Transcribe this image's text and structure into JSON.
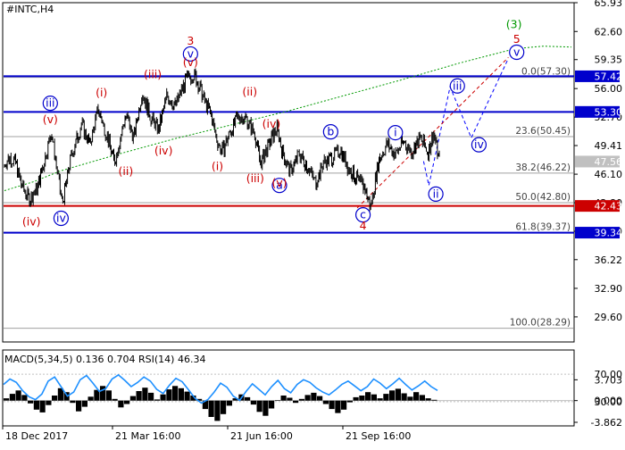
{
  "chart_data": {
    "type": "line",
    "symbol": "#INTC,H4",
    "price_panel": {
      "ylim": [
        26.7,
        65.93
      ],
      "y_ticks": [
        65.93,
        62.6,
        59.35,
        56.0,
        52.7,
        49.41,
        46.1,
        42.8,
        39.5,
        36.22,
        32.9,
        29.6
      ],
      "y_tick_labels": [
        "65.93",
        "62.60",
        "59.35",
        "56.00",
        "52.70",
        "49.41",
        "46.10",
        "42.80",
        "39.50",
        "36.22",
        "32.90",
        "29.60"
      ],
      "x_labels": [
        "18 Dec 2017",
        "21 Mar 16:00",
        "21 Jun 16:00",
        "21 Sep 16:00"
      ],
      "last_price": {
        "value": 47.56,
        "label": "47.56"
      },
      "levels": [
        {
          "value": 57.42,
          "label": "57.42",
          "color": "#0000cc"
        },
        {
          "value": 53.3,
          "label": "53.30",
          "color": "#0000cc"
        },
        {
          "value": 42.43,
          "label": "42.43",
          "color": "#cc0000"
        },
        {
          "value": 39.34,
          "label": "39.34",
          "color": "#0000cc"
        }
      ],
      "fibonacci": [
        {
          "value": 57.3,
          "label": "0.0(57.30)"
        },
        {
          "value": 50.45,
          "label": "23.6(50.45)"
        },
        {
          "value": 46.22,
          "label": "38.2(46.22)"
        },
        {
          "value": 42.8,
          "label": "50.0(42.80)"
        },
        {
          "value": 39.37,
          "label": "61.8(39.37)"
        },
        {
          "value": 28.29,
          "label": "100.0(28.29)"
        }
      ],
      "moving_average": {
        "color": "#009900",
        "points": [
          [
            0,
            44.2
          ],
          [
            0.05,
            45.2
          ],
          [
            0.1,
            46.5
          ],
          [
            0.2,
            48.4
          ],
          [
            0.3,
            50.2
          ],
          [
            0.4,
            51.8
          ],
          [
            0.5,
            53.4
          ],
          [
            0.6,
            55.2
          ],
          [
            0.7,
            57.0
          ],
          [
            0.8,
            58.9
          ],
          [
            0.9,
            60.6
          ],
          [
            0.95,
            60.9
          ],
          [
            1.0,
            60.8
          ]
        ]
      },
      "price_path": [
        [
          0,
          47.2
        ],
        [
          0.01,
          48.1
        ],
        [
          0.02,
          47.5
        ],
        [
          0.03,
          45.0
        ],
        [
          0.045,
          43.2
        ],
        [
          0.06,
          44.5
        ],
        [
          0.075,
          48.3
        ],
        [
          0.085,
          51.0
        ],
        [
          0.095,
          46.8
        ],
        [
          0.105,
          42.6
        ],
        [
          0.12,
          47.8
        ],
        [
          0.14,
          51.9
        ],
        [
          0.155,
          49.5
        ],
        [
          0.17,
          53.6
        ],
        [
          0.185,
          50.8
        ],
        [
          0.2,
          47.5
        ],
        [
          0.22,
          52.9
        ],
        [
          0.235,
          50.3
        ],
        [
          0.25,
          55.6
        ],
        [
          0.265,
          52.8
        ],
        [
          0.28,
          51.2
        ],
        [
          0.295,
          55.2
        ],
        [
          0.31,
          54.0
        ],
        [
          0.33,
          57.0
        ],
        [
          0.345,
          57.6
        ],
        [
          0.355,
          56.1
        ],
        [
          0.365,
          54.3
        ],
        [
          0.375,
          53.1
        ],
        [
          0.385,
          50.2
        ],
        [
          0.395,
          48.6
        ],
        [
          0.41,
          51.0
        ],
        [
          0.425,
          52.8
        ],
        [
          0.44,
          52.5
        ],
        [
          0.455,
          50.7
        ],
        [
          0.465,
          47.3
        ],
        [
          0.48,
          49.5
        ],
        [
          0.495,
          51.4
        ],
        [
          0.505,
          48.6
        ],
        [
          0.52,
          46.4
        ],
        [
          0.535,
          48.4
        ],
        [
          0.55,
          47.1
        ],
        [
          0.565,
          45.1
        ],
        [
          0.58,
          47.5
        ],
        [
          0.595,
          48.0
        ],
        [
          0.61,
          49.0
        ],
        [
          0.625,
          46.8
        ],
        [
          0.64,
          45.5
        ],
        [
          0.655,
          44.5
        ],
        [
          0.665,
          42.2
        ],
        [
          0.68,
          47.8
        ],
        [
          0.695,
          49.6
        ],
        [
          0.71,
          48.4
        ],
        [
          0.725,
          49.9
        ],
        [
          0.74,
          48.6
        ],
        [
          0.755,
          50.2
        ],
        [
          0.77,
          48.7
        ],
        [
          0.78,
          50.9
        ],
        [
          0.79,
          47.6
        ]
      ],
      "projection": [
        {
          "color": "#0000ff",
          "points": [
            [
              0.79,
              47.6
            ],
            [
              0.8,
              44.8
            ],
            [
              0.84,
              56.2
            ],
            [
              0.88,
              50.3
            ],
            [
              0.95,
              59.5
            ]
          ]
        },
        {
          "color": "#cc0000",
          "points": [
            [
              0.665,
              42.2
            ],
            [
              0.95,
              59.6
            ]
          ]
        }
      ],
      "waves": [
        {
          "label": "(iv)",
          "t": 0.05,
          "v": 40.6,
          "color": "#cc0000",
          "circle": false
        },
        {
          "label": "(v)",
          "t": 0.085,
          "v": 52.4,
          "color": "#cc0000",
          "circle": false
        },
        {
          "label": "iii",
          "t": 0.085,
          "v": 54.3,
          "color": "#0000cc",
          "circle": true
        },
        {
          "label": "iv",
          "t": 0.105,
          "v": 41.0,
          "color": "#0000cc",
          "circle": true
        },
        {
          "label": "(i)",
          "t": 0.18,
          "v": 55.5,
          "color": "#cc0000",
          "circle": false
        },
        {
          "label": "(ii)",
          "t": 0.225,
          "v": 46.4,
          "color": "#cc0000",
          "circle": false
        },
        {
          "label": "(iii)",
          "t": 0.275,
          "v": 57.6,
          "color": "#cc0000",
          "circle": false
        },
        {
          "label": "(iv)",
          "t": 0.295,
          "v": 48.8,
          "color": "#cc0000",
          "circle": false
        },
        {
          "label": "3",
          "t": 0.345,
          "v": 61.5,
          "color": "#cc0000",
          "circle": false
        },
        {
          "label": "v",
          "t": 0.345,
          "v": 60.0,
          "color": "#0000cc",
          "circle": true
        },
        {
          "label": "(v)",
          "t": 0.345,
          "v": 59.0,
          "color": "#cc0000",
          "circle": false
        },
        {
          "label": "(i)",
          "t": 0.395,
          "v": 47.0,
          "color": "#cc0000",
          "circle": false
        },
        {
          "label": "(ii)",
          "t": 0.455,
          "v": 55.6,
          "color": "#cc0000",
          "circle": false
        },
        {
          "label": "(iii)",
          "t": 0.465,
          "v": 45.6,
          "color": "#cc0000",
          "circle": false
        },
        {
          "label": "(iv)",
          "t": 0.495,
          "v": 51.9,
          "color": "#cc0000",
          "circle": false
        },
        {
          "label": "a",
          "t": 0.51,
          "v": 44.8,
          "color": "#0000cc",
          "circle": true
        },
        {
          "label": "(v)",
          "t": 0.51,
          "v": 45.1,
          "color": "#cc0000",
          "circle": false
        },
        {
          "label": "b",
          "t": 0.605,
          "v": 51.0,
          "color": "#0000cc",
          "circle": true
        },
        {
          "label": "i",
          "t": 0.725,
          "v": 50.9,
          "color": "#0000cc",
          "circle": true
        },
        {
          "label": "c",
          "t": 0.665,
          "v": 41.4,
          "color": "#0000cc",
          "circle": true
        },
        {
          "label": "4",
          "t": 0.665,
          "v": 40.1,
          "color": "#cc0000",
          "circle": false
        },
        {
          "label": "ii",
          "t": 0.8,
          "v": 43.8,
          "color": "#0000cc",
          "circle": true
        },
        {
          "label": "iii",
          "t": 0.84,
          "v": 56.3,
          "color": "#0000cc",
          "circle": true
        },
        {
          "label": "iv",
          "t": 0.88,
          "v": 49.5,
          "color": "#0000cc",
          "circle": true
        },
        {
          "label": "5",
          "t": 0.95,
          "v": 61.7,
          "color": "#cc0000",
          "circle": false
        },
        {
          "label": "(3)",
          "t": 0.945,
          "v": 63.4,
          "color": "#009900",
          "circle": false
        },
        {
          "label": "v",
          "t": 0.95,
          "v": 60.2,
          "color": "#0000cc",
          "circle": true
        }
      ]
    },
    "indicator_panel": {
      "title": "MACD(5,34,5) 0.136 0.704 RSI(14) 46.34",
      "ylim": [
        -4.5,
        9.0
      ],
      "y_ticks": [
        3.703,
        0.0,
        -3.862
      ],
      "y_tick_labels": [
        "3.703",
        "0.000",
        "-3.862"
      ],
      "rsi_ticks": [
        70.0,
        30.0
      ],
      "rsi_tick_labels": [
        "70.00",
        "30.00"
      ],
      "macd_hist": [
        0.4,
        1.2,
        1.8,
        1.0,
        -0.5,
        -1.6,
        -2.1,
        -0.8,
        0.9,
        2.2,
        1.5,
        -0.4,
        -1.9,
        -1.1,
        0.7,
        1.9,
        2.6,
        1.8,
        0.3,
        -1.2,
        -0.6,
        0.8,
        1.7,
        2.3,
        1.4,
        0.2,
        1.1,
        2.0,
        2.6,
        2.2,
        1.6,
        0.9,
        0.3,
        -1.5,
        -2.9,
        -3.6,
        -2.4,
        -0.9,
        0.4,
        1.1,
        0.6,
        -0.7,
        -2.0,
        -2.7,
        -1.4,
        0.1,
        0.9,
        0.5,
        -0.4,
        0.3,
        1.0,
        1.4,
        0.8,
        -0.6,
        -1.5,
        -2.2,
        -1.6,
        -0.3,
        0.6,
        0.9,
        1.5,
        1.1,
        0.4,
        1.2,
        1.8,
        2.1,
        1.3,
        0.7,
        1.5,
        1.0,
        0.4,
        0.136
      ],
      "rsi": [
        55,
        63,
        58,
        46,
        37,
        33,
        41,
        60,
        66,
        52,
        38,
        44,
        62,
        68,
        57,
        45,
        49,
        63,
        69,
        61,
        52,
        58,
        66,
        60,
        48,
        42,
        54,
        64,
        59,
        47,
        35,
        28,
        33,
        44,
        57,
        51,
        38,
        32,
        45,
        56,
        48,
        40,
        52,
        61,
        49,
        43,
        55,
        62,
        58,
        50,
        44,
        40,
        47,
        55,
        60,
        53,
        46,
        52,
        63,
        57,
        49,
        56,
        64,
        55,
        47,
        53,
        60,
        52,
        46.34
      ]
    }
  }
}
